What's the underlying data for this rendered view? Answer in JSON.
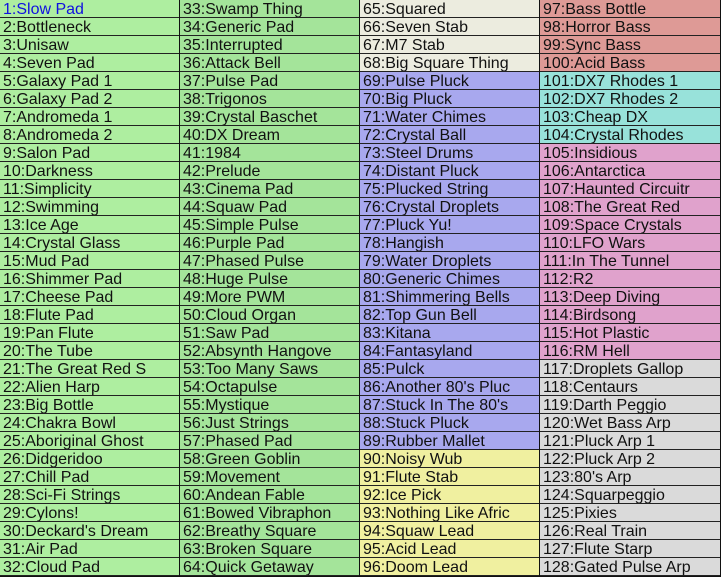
{
  "colors": {
    "green1": "#aeeea0",
    "green2": "#a4e49a",
    "ivory": "#ececdf",
    "purple": "#a8a8ee",
    "yellow": "#f0f0a0",
    "salmon": "#de9a96",
    "cyan": "#98e2da",
    "pink": "#e0a2cc",
    "gray": "#dadada",
    "selected_text": "#1010e0"
  },
  "selected_index": 1,
  "groups": [
    {
      "from": 1,
      "to": 32,
      "color": "green1"
    },
    {
      "from": 33,
      "to": 64,
      "color": "green2"
    },
    {
      "from": 65,
      "to": 68,
      "color": "ivory"
    },
    {
      "from": 69,
      "to": 89,
      "color": "purple"
    },
    {
      "from": 90,
      "to": 96,
      "color": "yellow"
    },
    {
      "from": 97,
      "to": 100,
      "color": "salmon"
    },
    {
      "from": 101,
      "to": 104,
      "color": "cyan"
    },
    {
      "from": 105,
      "to": 116,
      "color": "pink"
    },
    {
      "from": 117,
      "to": 128,
      "color": "gray"
    }
  ],
  "patches": [
    "1:Slow Pad",
    "2:Bottleneck",
    "3:Unisaw",
    "4:Seven Pad",
    "5:Galaxy Pad 1",
    "6:Galaxy Pad 2",
    "7:Andromeda 1",
    "8:Andromeda 2",
    "9:Salon Pad",
    "10:Darkness",
    "11:Simplicity",
    "12:Swimming",
    "13:Ice Age",
    "14:Crystal Glass",
    "15:Mud Pad",
    "16:Shimmer Pad",
    "17:Cheese Pad",
    "18:Flute Pad",
    "19:Pan Flute",
    "20:The Tube",
    "21:The Great Red S",
    "22:Alien Harp",
    "23:Big Bottle",
    "24:Chakra Bowl",
    "25:Aboriginal Ghost",
    "26:Didgeridoo",
    "27:Chill Pad",
    "28:Sci-Fi Strings",
    "29:Cylons!",
    "30:Deckard's Dream",
    "31:Air Pad",
    "32:Cloud Pad",
    "33:Swamp Thing",
    "34:Generic Pad",
    "35:Interrupted",
    "36:Attack Bell",
    "37:Pulse Pad",
    "38:Trigonos",
    "39:Crystal Baschet",
    "40:DX Dream",
    "41:1984",
    "42:Prelude",
    "43:Cinema Pad",
    "44:Squaw Pad",
    "45:Simple Pulse",
    "46:Purple Pad",
    "47:Phased Pulse",
    "48:Huge Pulse",
    "49:More PWM",
    "50:Cloud Organ",
    "51:Saw Pad",
    "52:Absynth Hangove",
    "53:Too Many Saws",
    "54:Octapulse",
    "55:Mystique",
    "56:Just Strings",
    "57:Phased Pad",
    "58:Green Goblin",
    "59:Movement",
    "60:Andean Fable",
    "61:Bowed Vibraphon",
    "62:Breathy Square",
    "63:Broken Square",
    "64:Quick Getaway",
    "65:Squared",
    "66:Seven Stab",
    "67:M7 Stab",
    "68:Big Square Thing",
    "69:Pulse Pluck",
    "70:Big Pluck",
    "71:Water Chimes",
    "72:Crystal Ball",
    "73:Steel Drums",
    "74:Distant Pluck",
    "75:Plucked String",
    "76:Crystal Droplets",
    "77:Pluck Yu!",
    "78:Hangish",
    "79:Water Droplets",
    "80:Generic Chimes",
    "81:Shimmering Bells",
    "82:Top Gun Bell",
    "83:Kitana",
    "84:Fantasyland",
    "85:Pulck",
    "86:Another 80's Pluc",
    "87:Stuck In The 80's",
    "88:Stuck Pluck",
    "89:Rubber Mallet",
    "90:Noisy Wub",
    "91:Flute Stab",
    "92:Ice Pick",
    "93:Nothing Like Afric",
    "94:Squaw Lead",
    "95:Acid Lead",
    "96:Doom Lead",
    "97:Bass Bottle",
    "98:Horror Bass",
    "99:Sync Bass",
    "100:Acid Bass",
    "101:DX7 Rhodes 1",
    "102:DX7 Rhodes 2",
    "103:Cheap DX",
    "104:Crystal Rhodes",
    "105:Insidious",
    "106:Antarctica",
    "107:Haunted Circuitr",
    "108:The Great Red",
    "109:Space Crystals",
    "110:LFO Wars",
    "111:In The Tunnel",
    "112:R2",
    "113:Deep Diving",
    "114:Birdsong",
    "115:Hot Plastic",
    "116:RM Hell",
    "117:Droplets Gallop",
    "118:Centaurs",
    "119:Darth Peggio",
    "120:Wet Bass Arp",
    "121:Pluck Arp 1",
    "122:Pluck Arp 2",
    "123:80's Arp",
    "124:Squarpeggio",
    "125:Pixies",
    "126:Real Train",
    "127:Flute Starp",
    "128:Gated Pulse Arp"
  ]
}
